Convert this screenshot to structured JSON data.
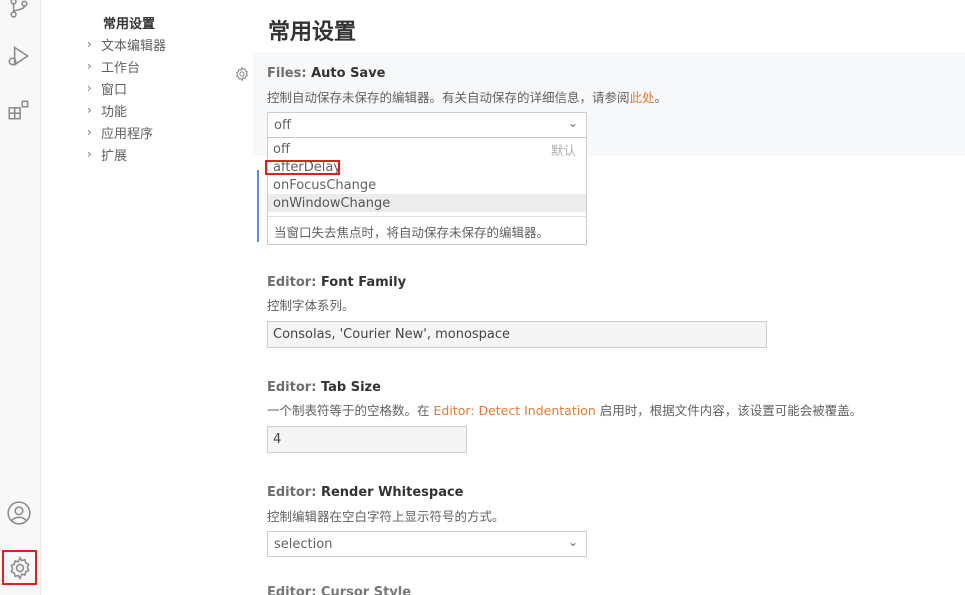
{
  "activity_icons": [
    "source-control-icon",
    "run-debug-icon",
    "extensions-icon",
    "account-icon",
    "manage-gear-icon"
  ],
  "toc": {
    "header": "常用设置",
    "items": [
      {
        "label": "文本编辑器"
      },
      {
        "label": "工作台"
      },
      {
        "label": "窗口"
      },
      {
        "label": "功能"
      },
      {
        "label": "应用程序"
      },
      {
        "label": "扩展"
      }
    ]
  },
  "page": {
    "title": "常用设置"
  },
  "auto_save": {
    "category": "Files: ",
    "name": "Auto Save",
    "desc_prefix": "控制自动保存未保存的编辑器。有关自动保存的详细信息，请参阅",
    "desc_link": "此处",
    "desc_suffix": "。",
    "value": "off",
    "options": [
      "off",
      "afterDelay",
      "onFocusChange",
      "onWindowChange"
    ],
    "default_label": "默认",
    "hovered_option_desc": "当窗口失去焦点时，将自动保存未保存的编辑器。"
  },
  "font_family": {
    "category": "Editor: ",
    "name": "Font Family",
    "desc": "控制字体系列。",
    "value": "Consolas, 'Courier New', monospace"
  },
  "tab_size": {
    "category": "Editor: ",
    "name": "Tab Size",
    "desc_prefix": "一个制表符等于的空格数。在 ",
    "desc_link": "Editor: Detect Indentation",
    "desc_suffix": " 启用时，根据文件内容，该设置可能会被覆盖。",
    "value": "4"
  },
  "render_whitespace": {
    "category": "Editor: ",
    "name": "Render Whitespace",
    "desc": "控制编辑器在空白字符上显示符号的方式。",
    "value": "selection"
  },
  "next_setting": {
    "text": "Editor: Cursor Style"
  },
  "colors": {
    "link": "#e37933",
    "highlight_box": "#e02020",
    "focus_bar": "#5b8ed6"
  }
}
